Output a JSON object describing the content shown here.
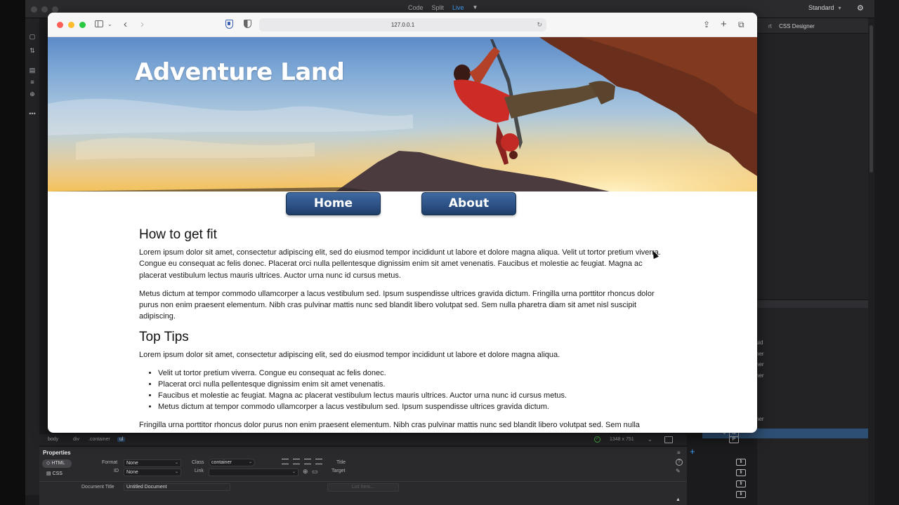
{
  "app": {
    "view_modes": [
      "Code",
      "Split",
      "Live"
    ],
    "active_view": "Live",
    "workspace": "Standard",
    "right_panel_tabs": [
      "rt",
      "CSS Designer"
    ],
    "dom_partial_labels": [
      "luid",
      "ner",
      "ner",
      "ner",
      "ner"
    ],
    "dom_selected_tag": "ul",
    "dom_children_tag": "li"
  },
  "browser": {
    "url": "127.0.0.1"
  },
  "page": {
    "site_title": "Adventure Land",
    "nav": [
      "Home",
      "About"
    ],
    "section1_heading": "How to get fit",
    "section1_p1": "Lorem ipsum dolor sit amet, consectetur adipiscing elit, sed do eiusmod tempor incididunt ut labore et dolore magna aliqua. Velit ut tortor pretium viverra. Congue eu consequat ac felis donec. Placerat orci nulla pellentesque dignissim enim sit amet venenatis. Faucibus et molestie ac feugiat. Magna ac placerat vestibulum lectus mauris ultrices. Auctor urna nunc id cursus metus.",
    "section1_p2": "Metus dictum at tempor commodo ullamcorper a lacus vestibulum sed. Ipsum suspendisse ultrices gravida dictum. Fringilla urna porttitor rhoncus dolor purus non enim praesent elementum. Nibh cras pulvinar mattis nunc sed blandit libero volutpat sed. Sem nulla pharetra diam sit amet nisl suscipit adipiscing.",
    "section2_heading": "Top Tips",
    "section2_intro": "Lorem ipsum dolor sit amet, consectetur adipiscing elit, sed do eiusmod tempor incididunt ut labore et dolore magna aliqua.",
    "tips": [
      "Velit ut tortor pretium viverra. Congue eu consequat ac felis donec.",
      "Placerat orci nulla pellentesque dignissim enim sit amet venenatis.",
      "Faucibus et molestie ac feugiat. Magna ac placerat vestibulum lectus mauris ultrices. Auctor urna nunc id cursus metus.",
      "Metus dictum at tempor commodo ullamcorper a lacus vestibulum sed. Ipsum suspendisse ultrices gravida dictum."
    ],
    "section2_outro": "Fringilla urna porttitor rhoncus dolor purus non enim praesent elementum. Nibh cras pulvinar mattis nunc sed blandit libero volutpat sed. Sem nulla"
  },
  "status": {
    "breadcrumbs": [
      "body",
      "div",
      ".container",
      "ul"
    ],
    "screen_size": "1348 x 751"
  },
  "properties": {
    "title": "Properties",
    "html_tab": "HTML",
    "css_tab": "CSS",
    "format_label": "Format",
    "format_value": "None",
    "id_label": "ID",
    "id_value": "None",
    "class_label": "Class",
    "class_value": "container",
    "link_label": "Link",
    "title_label": "Title",
    "target_label": "Target",
    "doc_title_label": "Document Title",
    "doc_title_value": "Untitled Document",
    "list_item_button": "List Item..."
  },
  "colors": {
    "accent": "#3ea1f5",
    "nav_button": "#2d5286"
  }
}
